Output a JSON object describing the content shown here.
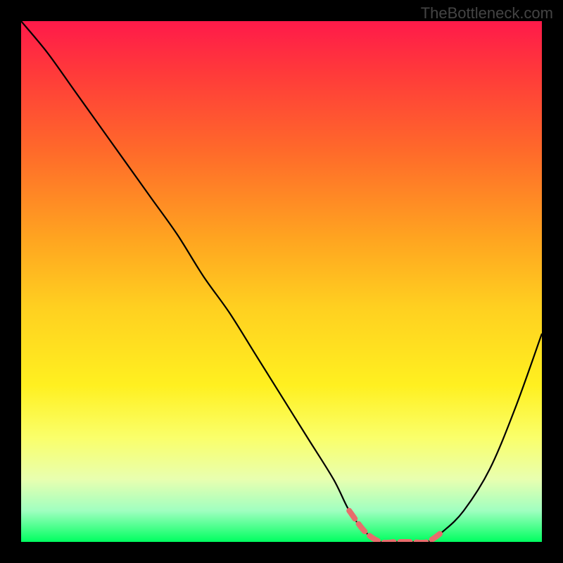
{
  "watermark": "TheBottleneck.com",
  "chart_data": {
    "type": "line",
    "title": "",
    "xlabel": "",
    "ylabel": "",
    "xlim": [
      0,
      100
    ],
    "ylim": [
      0,
      100
    ],
    "series": [
      {
        "name": "bottleneck-curve",
        "x": [
          0,
          5,
          10,
          15,
          20,
          25,
          30,
          35,
          40,
          45,
          50,
          55,
          60,
          63,
          66,
          69,
          72,
          75,
          78,
          81,
          85,
          90,
          95,
          100
        ],
        "values": [
          100,
          94,
          87,
          80,
          73,
          66,
          59,
          51,
          44,
          36,
          28,
          20,
          12,
          6,
          2,
          0,
          0,
          0,
          0,
          2,
          6,
          14,
          26,
          40
        ]
      }
    ],
    "highlight": {
      "name": "optimal-range",
      "color": "#e86c6c",
      "x_start": 63,
      "x_end": 82
    },
    "gradient_stops": [
      {
        "pos": 0,
        "color": "#ff1a4a"
      },
      {
        "pos": 25,
        "color": "#ff6a2a"
      },
      {
        "pos": 55,
        "color": "#ffd020"
      },
      {
        "pos": 80,
        "color": "#faff6a"
      },
      {
        "pos": 100,
        "color": "#00ff60"
      }
    ]
  }
}
